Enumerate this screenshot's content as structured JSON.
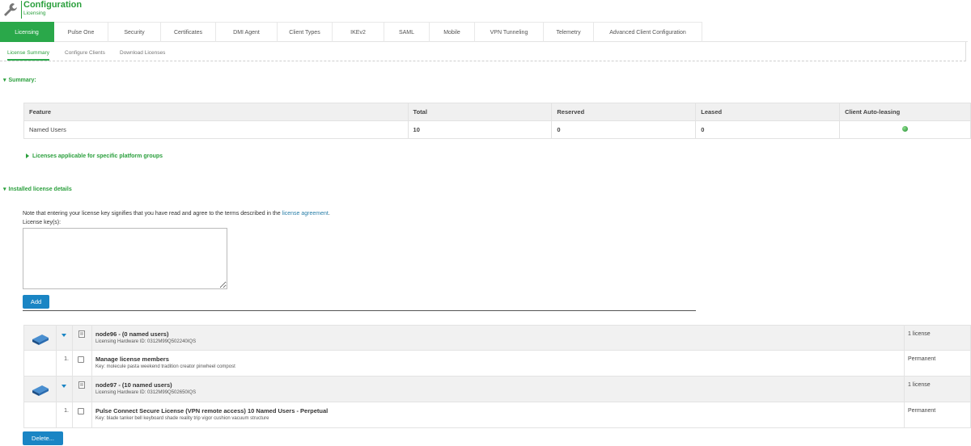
{
  "header": {
    "title": "Configuration",
    "subtitle": "Licensing"
  },
  "tabs": [
    {
      "label": "Licensing",
      "active": true
    },
    {
      "label": "Pulse One"
    },
    {
      "label": "Security"
    },
    {
      "label": "Certificates"
    },
    {
      "label": "DMI Agent"
    },
    {
      "label": "Client Types"
    },
    {
      "label": "IKEv2"
    },
    {
      "label": "SAML"
    },
    {
      "label": "Mobile"
    },
    {
      "label": "VPN Tunneling"
    },
    {
      "label": "Telemetry"
    },
    {
      "label": "Advanced Client Configuration"
    }
  ],
  "subtabs": [
    {
      "label": "License Summary",
      "active": true
    },
    {
      "label": "Configure Clients"
    },
    {
      "label": "Download Licenses"
    }
  ],
  "summary": {
    "toggle_label": "Summary:",
    "columns": [
      "Feature",
      "Total",
      "Reserved",
      "Leased",
      "Client Auto-leasing"
    ],
    "rows": [
      {
        "feature": "Named Users",
        "total": "10",
        "reserved": "0",
        "leased": "0",
        "auto_leasing": "enabled"
      }
    ],
    "platform_groups_label": "Licenses applicable for specific platform groups"
  },
  "installed": {
    "toggle_label": "Installed license details",
    "note_prefix": "Note that entering your license key signifies that you have read and agree to the terms described in the",
    "note_link": "license agreement",
    "note_suffix": ".",
    "key_label": "License key(s):",
    "key_value": "",
    "add_label": "Add",
    "delete_label": "Delete...",
    "nodes": [
      {
        "name": "node96 - (0 named users)",
        "hardware": "Licensing Hardware ID: 0312M99Q502240IQS",
        "count": "1 license",
        "licenses": [
          {
            "index": "1.",
            "name": "Manage license members",
            "key": "Key: molecule pasta weekend tradition creator pinwheel compost",
            "status": "Permanent"
          }
        ]
      },
      {
        "name": "node97 - (10 named users)",
        "hardware": "Licensing Hardware ID: 0312M99Q502650IQS",
        "count": "1 license",
        "licenses": [
          {
            "index": "1.",
            "name": "Pulse Connect Secure License (VPN remote access) 10 Named Users - Perpetual",
            "key": "Key: blade tanker bell keyboard shade reality trip vigor cushion vacuum structure",
            "status": "Permanent"
          }
        ]
      }
    ]
  },
  "colors": {
    "accent": "#2aa84a",
    "button": "#1a85c4",
    "link": "#2a7fa8"
  }
}
